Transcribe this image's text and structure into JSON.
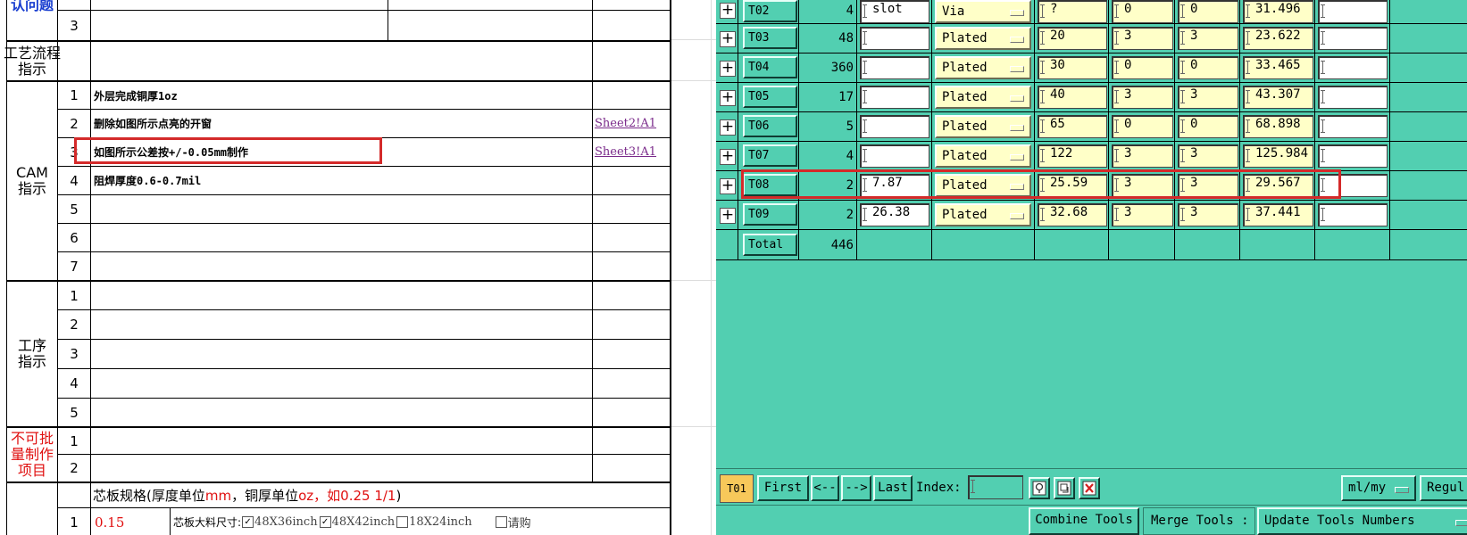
{
  "spreadsheet": {
    "sections": [
      {
        "label": "认问题",
        "color": "#1a3fd0"
      },
      {
        "label": "工艺流程\n指示",
        "color": "#000000"
      },
      {
        "label": "CAM\n指示",
        "color": "#000000"
      },
      {
        "label": "工序\n指示",
        "color": "#000000"
      },
      {
        "label": "不可批\n量制作\n项目",
        "color": "#e01010"
      }
    ],
    "row_numbers": {
      "top": [
        "3"
      ],
      "cam": [
        "1",
        "2",
        "3",
        "4",
        "5",
        "6",
        "7"
      ],
      "process": [
        "1",
        "2",
        "3",
        "4",
        "5"
      ],
      "unbatch": [
        "1",
        "2"
      ],
      "spec": [
        "1"
      ]
    },
    "cam_instructions": [
      {
        "text": "外层完成铜厚1oz",
        "link": ""
      },
      {
        "text": "删除如图所示点亮的开窗",
        "link": "Sheet2!A1"
      },
      {
        "text": "如图所示公差按+/-0.05mm制作",
        "link": "Sheet3!A1"
      },
      {
        "text": "阻焊厚度0.6-0.7mil",
        "link": ""
      }
    ],
    "core_spec": {
      "prefix": "芯板规格(厚度单位",
      "unit1": "mm",
      "mid": "，铜厚单位",
      "unit2": "oz",
      "example": "，如0.25 1/1",
      "suffix": ")"
    },
    "core_row": {
      "thickness": "0.15",
      "material_label": "芯板大料尺寸:",
      "options": [
        {
          "label": "48X36inch",
          "checked": true
        },
        {
          "label": "48X42inch",
          "checked": true
        },
        {
          "label": "18X24inch",
          "checked": false
        },
        {
          "label": "请购",
          "checked": false
        }
      ]
    }
  },
  "tools": {
    "rows": [
      {
        "name": "T02",
        "count": "4",
        "size": "slot",
        "type": "Via",
        "f1": "?",
        "f2": "0",
        "f3": "0",
        "f4": "31.496",
        "f5": ""
      },
      {
        "name": "T03",
        "count": "48",
        "size": "",
        "type": "Plated",
        "f1": "20",
        "f2": "3",
        "f3": "3",
        "f4": "23.622",
        "f5": ""
      },
      {
        "name": "T04",
        "count": "360",
        "size": "",
        "type": "Plated",
        "f1": "30",
        "f2": "0",
        "f3": "0",
        "f4": "33.465",
        "f5": ""
      },
      {
        "name": "T05",
        "count": "17",
        "size": "",
        "type": "Plated",
        "f1": "40",
        "f2": "3",
        "f3": "3",
        "f4": "43.307",
        "f5": ""
      },
      {
        "name": "T06",
        "count": "5",
        "size": "",
        "type": "Plated",
        "f1": "65",
        "f2": "0",
        "f3": "0",
        "f4": "68.898",
        "f5": ""
      },
      {
        "name": "T07",
        "count": "4",
        "size": "",
        "type": "Plated",
        "f1": "122",
        "f2": "3",
        "f3": "3",
        "f4": "125.984",
        "f5": ""
      },
      {
        "name": "T08",
        "count": "2",
        "size": "7.87",
        "type": "Plated",
        "f1": "25.59",
        "f2": "3",
        "f3": "3",
        "f4": "29.567",
        "f5": ""
      },
      {
        "name": "T09",
        "count": "2",
        "size": "26.38",
        "type": "Plated",
        "f1": "32.68",
        "f2": "3",
        "f3": "3",
        "f4": "37.441",
        "f5": ""
      }
    ],
    "total_label": "Total",
    "total_count": "446"
  },
  "navbar": {
    "current_tool": "T01",
    "first": "First",
    "prev": "<--",
    "next": "-->",
    "last": "Last",
    "index_label": "Index:",
    "index_value": "",
    "units": "ml/my",
    "regular": "Regul"
  },
  "bottom": {
    "combine": "Combine Tools",
    "merge": "Merge Tools :",
    "update": "Update Tools Numbers"
  }
}
